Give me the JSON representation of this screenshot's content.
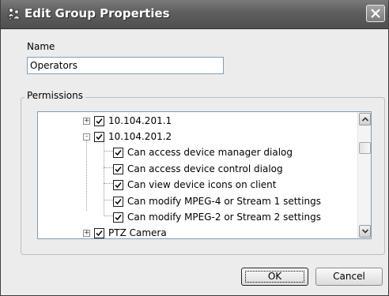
{
  "window": {
    "title": "Edit Group Properties",
    "icon": "group-users-icon",
    "close": "close-icon"
  },
  "form": {
    "name_label": "Name",
    "name_value": "Operators",
    "permissions_label": "Permissions"
  },
  "tree": {
    "nodes": [
      {
        "label": "10.104.201.1",
        "checked": true,
        "expander": "+",
        "level": 0
      },
      {
        "label": "10.104.201.2",
        "checked": true,
        "expander": "-",
        "level": 0
      },
      {
        "label": "Can access device manager dialog",
        "checked": true,
        "level": 1
      },
      {
        "label": "Can access device control dialog",
        "checked": true,
        "level": 1
      },
      {
        "label": "Can view device icons on client",
        "checked": true,
        "level": 1
      },
      {
        "label": "Can modify MPEG-4 or Stream 1 settings",
        "checked": true,
        "level": 1
      },
      {
        "label": "Can modify MPEG-2 or Stream 2 settings",
        "checked": true,
        "level": 1
      },
      {
        "label": "PTZ Camera",
        "checked": true,
        "expander": "+",
        "level": 0
      }
    ]
  },
  "buttons": {
    "ok": "OK",
    "cancel": "Cancel"
  },
  "colors": {
    "titlebar": "#5e5e5e",
    "input_border": "#7f9db9",
    "dialog_bg": "#ececec"
  }
}
